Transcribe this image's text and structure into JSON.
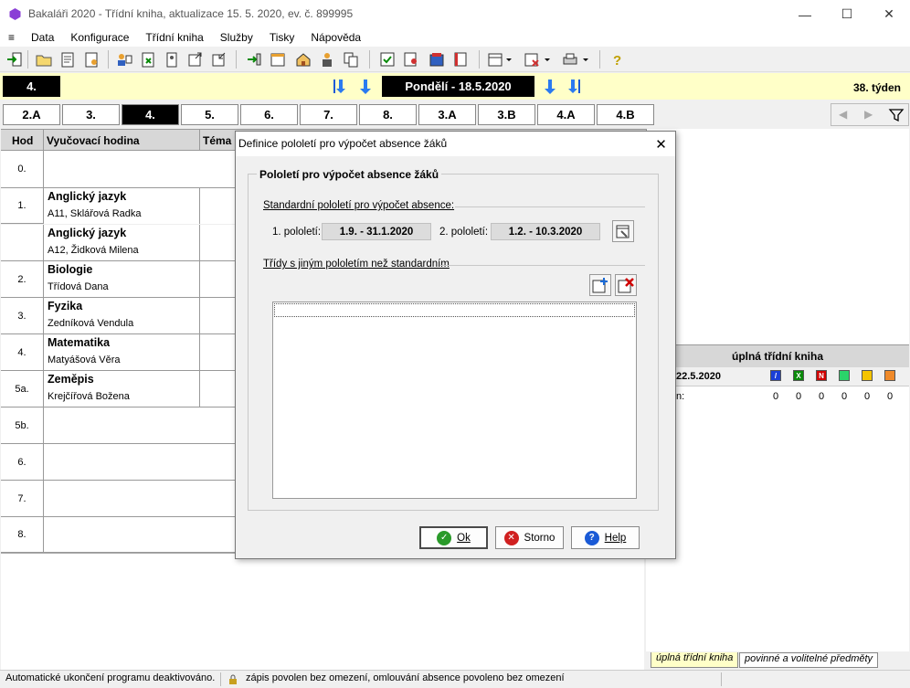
{
  "window": {
    "title": "Bakaláři 2020 - Třídní kniha, aktualizace 15. 5. 2020, ev. č. 899995",
    "minimize": "—",
    "maximize": "☐",
    "close": "✕"
  },
  "menu": {
    "items": [
      "≡",
      "Data",
      "Konfigurace",
      "Třídní kniha",
      "Služby",
      "Tisky",
      "Nápověda"
    ]
  },
  "daybar": {
    "lesson": "4.",
    "date": "Pondělí - 18.5.2020",
    "week": "38. týden"
  },
  "classes": [
    "2.A",
    "3.",
    "4.",
    "5.",
    "6.",
    "7.",
    "8.",
    "3.A",
    "3.B",
    "4.A",
    "4.B"
  ],
  "active_class": "4.",
  "timetable": {
    "headers": {
      "hod": "Hod",
      "hodina": "Vyučovací hodina",
      "tema": "Téma"
    },
    "rows": [
      {
        "num": "0.",
        "subject": "",
        "teacher": ""
      },
      {
        "num": "1.",
        "subject": "Anglický jazyk",
        "teacher": "A11, Sklářová Radka"
      },
      {
        "num": "",
        "subject": "Anglický jazyk",
        "teacher": "A12, Židková Milena"
      },
      {
        "num": "2.",
        "subject": "Biologie",
        "teacher": "Třídová Dana"
      },
      {
        "num": "3.",
        "subject": "Fyzika",
        "teacher": "Zedníková Vendula"
      },
      {
        "num": "4.",
        "subject": "Matematika",
        "teacher": "Matyášová Věra"
      },
      {
        "num": "5a.",
        "subject": "Zeměpis",
        "teacher": "Krejčířová Božena"
      },
      {
        "num": "5b.",
        "subject": "",
        "teacher": ""
      },
      {
        "num": "6.",
        "subject": "",
        "teacher": ""
      },
      {
        "num": "7.",
        "subject": "",
        "teacher": ""
      },
      {
        "num": "8.",
        "subject": "",
        "teacher": ""
      }
    ]
  },
  "right_panel": {
    "header": "úplná třídní kniha",
    "date": "22.5.2020",
    "row_label": "n:",
    "squares": [
      {
        "letter": "/",
        "color": "#1a3fd6"
      },
      {
        "letter": "X",
        "color": "#0a8a0a"
      },
      {
        "letter": "N",
        "color": "#d00000"
      },
      {
        "letter": "",
        "color": "#2bd46a"
      },
      {
        "letter": "",
        "color": "#f5c400"
      },
      {
        "letter": "",
        "color": "#f08a2a"
      }
    ],
    "counts": [
      "0",
      "0",
      "0",
      "0",
      "0",
      "0"
    ],
    "tabs": [
      "úplná třídní kniha",
      "povinné a volitelné předměty"
    ]
  },
  "status": {
    "left": "Automatické ukončení programu deaktivováno.",
    "right": "zápis povolen bez omezení, omlouvání absence povoleno bez omezení"
  },
  "dialog": {
    "title": "Definice pololetí pro výpočet absence žáků",
    "close": "✕",
    "group_title": "Pololetí pro výpočet absence žáků",
    "standard_label": "Standardní pololetí pro výpočet absence:",
    "p1_label": "1. pololetí:",
    "p1_value": "1.9. - 31.1.2020",
    "p2_label": "2. pololetí:",
    "p2_value": "1.2. - 10.3.2020",
    "other_label": "Třídy s jiným pololetím než standardním",
    "ok_label": "Ok",
    "cancel_label": "Storno",
    "help_label": "Help"
  }
}
